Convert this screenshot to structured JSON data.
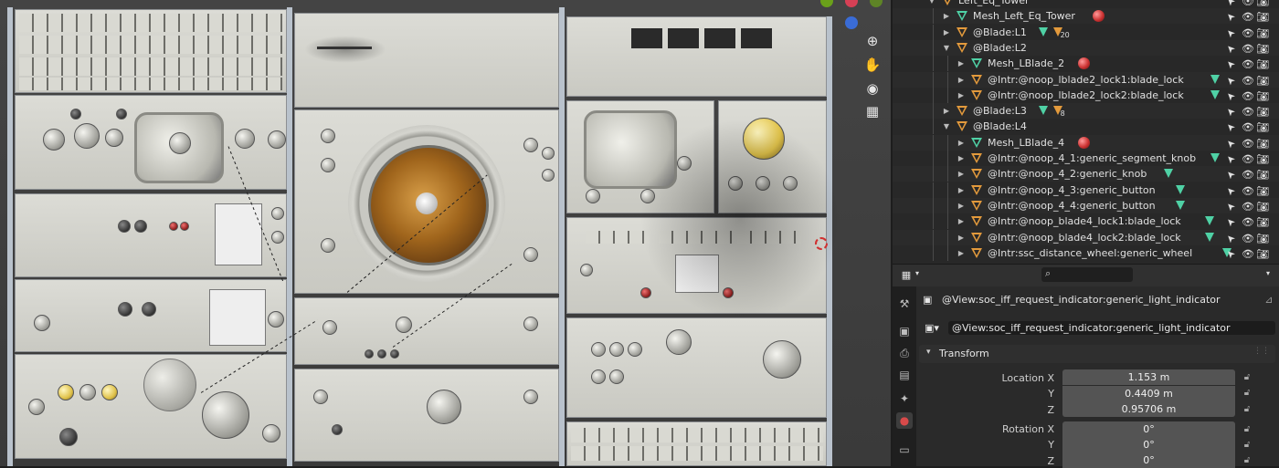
{
  "outliner": {
    "rows": [
      {
        "label": "Left_Eq_Tower",
        "type": "empty",
        "indent": 0,
        "expanded": true,
        "children": "",
        "visible": false
      },
      {
        "label": "Mesh_Left_Eq_Tower",
        "type": "mesh",
        "indent": 1,
        "expanded": false,
        "children": "",
        "material": true
      },
      {
        "label": "@Blade:L1",
        "type": "empty",
        "indent": 1,
        "expanded": false,
        "children": "20"
      },
      {
        "label": "@Blade:L2",
        "type": "empty",
        "indent": 1,
        "expanded": true,
        "children": ""
      },
      {
        "label": "Mesh_LBlade_2",
        "type": "mesh",
        "indent": 2,
        "expanded": false,
        "children": "",
        "material": true
      },
      {
        "label": "@Intr:@noop_lblade2_lock1:blade_lock",
        "type": "empty",
        "indent": 2,
        "expanded": false,
        "children": "m"
      },
      {
        "label": "@Intr:@noop_lblade2_lock2:blade_lock",
        "type": "empty",
        "indent": 2,
        "expanded": false,
        "children": "m"
      },
      {
        "label": "@Blade:L3",
        "type": "empty",
        "indent": 1,
        "expanded": false,
        "children": "8"
      },
      {
        "label": "@Blade:L4",
        "type": "empty",
        "indent": 1,
        "expanded": true,
        "children": ""
      },
      {
        "label": "Mesh_LBlade_4",
        "type": "mesh",
        "indent": 2,
        "expanded": false,
        "children": "",
        "material": true
      },
      {
        "label": "@Intr:@noop_4_1:generic_segment_knob",
        "type": "empty",
        "indent": 2,
        "expanded": false,
        "children": "m"
      },
      {
        "label": "@Intr:@noop_4_2:generic_knob",
        "type": "empty",
        "indent": 2,
        "expanded": false,
        "children": "m"
      },
      {
        "label": "@Intr:@noop_4_3:generic_button",
        "type": "empty",
        "indent": 2,
        "expanded": false,
        "children": "m"
      },
      {
        "label": "@Intr:@noop_4_4:generic_button",
        "type": "empty",
        "indent": 2,
        "expanded": false,
        "children": "m"
      },
      {
        "label": "@Intr:@noop_blade4_lock1:blade_lock",
        "type": "empty",
        "indent": 2,
        "expanded": false,
        "children": "m"
      },
      {
        "label": "@Intr:@noop_blade4_lock2:blade_lock",
        "type": "empty",
        "indent": 2,
        "expanded": false,
        "children": "m"
      },
      {
        "label": "@Intr:ssc_distance_wheel:generic_wheel",
        "type": "empty",
        "indent": 2,
        "expanded": false,
        "children": "m"
      }
    ]
  },
  "properties": {
    "context_object": "@View:soc_iff_request_indicator:generic_light_indicator",
    "object_name": "@View:soc_iff_request_indicator:generic_light_indicator",
    "panel_title": "Transform",
    "location_label": "Location X",
    "location": {
      "x": "1.153 m",
      "y": "0.4409 m",
      "z": "0.95706 m"
    },
    "rotation_label": "Rotation X",
    "rotation": {
      "x": "0°",
      "y": "0°",
      "z": "0°"
    },
    "axis_y": "Y",
    "axis_z": "Z"
  },
  "colors": {
    "empty_icon": "#e39a3c",
    "mesh_icon": "#4fd1a5",
    "material_icon": "#cc3333",
    "panel_bg": "#2a2a2a"
  }
}
